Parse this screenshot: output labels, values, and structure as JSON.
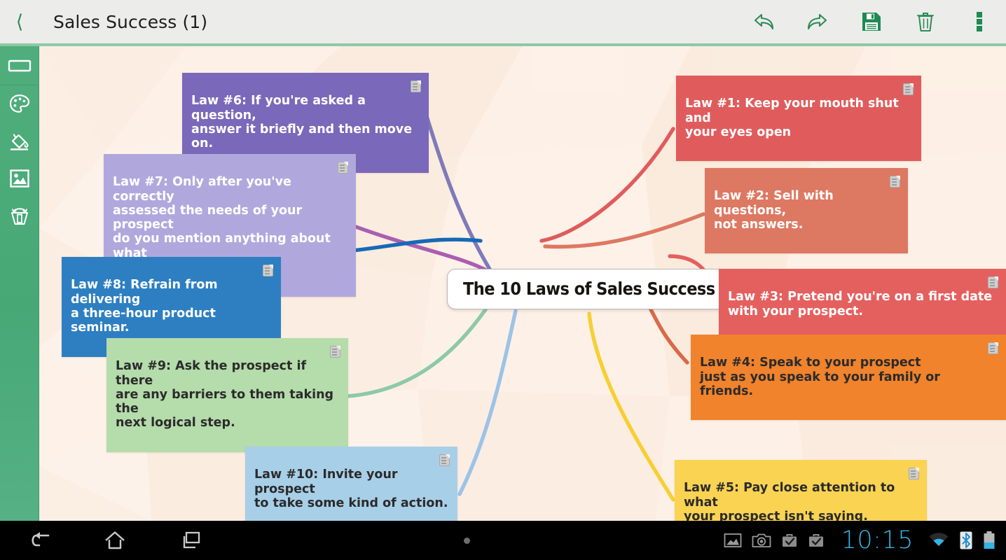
{
  "appbar": {
    "back_icon": "chevron-left-icon",
    "title": "Sales Success (1)",
    "actions": [
      {
        "name": "undo-button",
        "icon": "undo-icon",
        "label": "Undo"
      },
      {
        "name": "redo-button",
        "icon": "redo-icon",
        "label": "Redo"
      },
      {
        "name": "save-button",
        "icon": "save-floppy-icon",
        "label": "Save"
      },
      {
        "name": "delete-button",
        "icon": "trash-icon",
        "label": "Delete"
      },
      {
        "name": "overflow-menu-button",
        "icon": "more-vertical-icon",
        "label": "More options"
      }
    ],
    "accent_color": "#2e8b57",
    "underline_color": "#8cc9a6"
  },
  "sidebar": {
    "background_color": "#4fae7c",
    "items": [
      {
        "name": "sidebar-item-node-shape",
        "icon": "rectangle-node-icon",
        "label": "Node shape"
      },
      {
        "name": "sidebar-item-palette",
        "icon": "paint-palette-icon",
        "label": "Colors"
      },
      {
        "name": "sidebar-item-fill",
        "icon": "paint-bucket-icon",
        "label": "Fill"
      },
      {
        "name": "sidebar-item-image",
        "icon": "image-icon",
        "label": "Image"
      },
      {
        "name": "sidebar-item-recycle",
        "icon": "recycle-bin-icon",
        "label": "Recycle bin"
      }
    ]
  },
  "canvas": {
    "background_color": "#fdf2e9",
    "center_node": {
      "text": "The 10 Laws of Sales Success",
      "badge_icon": "pill-badge-icon"
    },
    "nodes": [
      {
        "id": "law-1",
        "text": "Law #1: Keep your mouth shut and\nyour eyes open",
        "color": "#e05c5c",
        "text_color": "#ffffff",
        "note_icon": "note-icon"
      },
      {
        "id": "law-2",
        "text": "Law #2: Sell with questions,\nnot answers.",
        "color": "#dd7862",
        "text_color": "#ffffff",
        "note_icon": "note-icon"
      },
      {
        "id": "law-3",
        "text": "Law #3: Pretend you're on a first date\nwith your prospect.",
        "color": "#e4605f",
        "text_color": "#ffffff",
        "note_icon": "note-icon"
      },
      {
        "id": "law-4",
        "text": "Law #4: Speak to your prospect\njust as you speak to your family or friends.",
        "color": "#f0832c",
        "text_color": "#2b2b2b",
        "note_icon": "note-icon"
      },
      {
        "id": "law-5",
        "text": "Law #5: Pay close attention to what\nyour prospect isn't saying.",
        "color": "#fad352",
        "text_color": "#2b2b2b",
        "note_icon": "note-icon"
      },
      {
        "id": "law-6",
        "text": "Law #6: If you're asked a question,\nanswer it briefly and then move on.",
        "color": "#7a68ba",
        "text_color": "#ffffff",
        "note_icon": "note-icon"
      },
      {
        "id": "law-7",
        "text": "Law #7: Only after you've correctly\nassessed the needs of your prospect\ndo you mention anything about what\nyou're offering.",
        "color": "#b0a8dd",
        "text_color": "#ffffff",
        "note_icon": "note-icon"
      },
      {
        "id": "law-8",
        "text": "Law #8: Refrain from delivering\na three-hour product seminar.",
        "color": "#2d7fc1",
        "text_color": "#ffffff",
        "note_icon": "note-icon"
      },
      {
        "id": "law-9",
        "text": "Law #9: Ask the prospect if there\nare any barriers to them taking the\nnext logical step.",
        "color": "#b5dcab",
        "text_color": "#2b2b2b",
        "note_icon": "note-icon"
      },
      {
        "id": "law-10",
        "text": "Law #10: Invite your prospect\nto take some kind of action.",
        "color": "#a8cfe8",
        "text_color": "#2b2b2b",
        "note_icon": "note-icon"
      }
    ],
    "branch_colors": {
      "law-1": "#e05c5c",
      "law-2": "#dd7862",
      "law-3": "#e4605f",
      "law-4": "#d9694a",
      "law-5": "#f7cf33",
      "law-6": "#7f7ab9",
      "law-7": "#a95fb0",
      "law-8": "#1769b5",
      "law-9": "#8dc9a8",
      "law-10": "#9cc3e8"
    }
  },
  "systembar": {
    "nav": [
      {
        "name": "android-back-button",
        "icon": "back-arrow-icon",
        "label": "Back"
      },
      {
        "name": "android-home-button",
        "icon": "home-icon",
        "label": "Home"
      },
      {
        "name": "android-recents-button",
        "icon": "recents-icon",
        "label": "Recent apps"
      }
    ],
    "menu_dot": "menu-dot-icon",
    "status": [
      {
        "name": "gallery-status-icon",
        "icon": "image-icon"
      },
      {
        "name": "camera-status-icon",
        "icon": "camera-icon"
      },
      {
        "name": "download-complete-icon-1",
        "icon": "briefcase-check-icon"
      },
      {
        "name": "download-complete-icon-2",
        "icon": "briefcase-check-icon"
      }
    ],
    "clock": "10:15",
    "clock_color": "#34b4e4",
    "indicators": [
      {
        "name": "wifi-icon",
        "icon": "wifi-icon"
      },
      {
        "name": "bluetooth-icon",
        "icon": "bluetooth-icon"
      },
      {
        "name": "battery-icon",
        "icon": "battery-low-icon"
      }
    ]
  }
}
